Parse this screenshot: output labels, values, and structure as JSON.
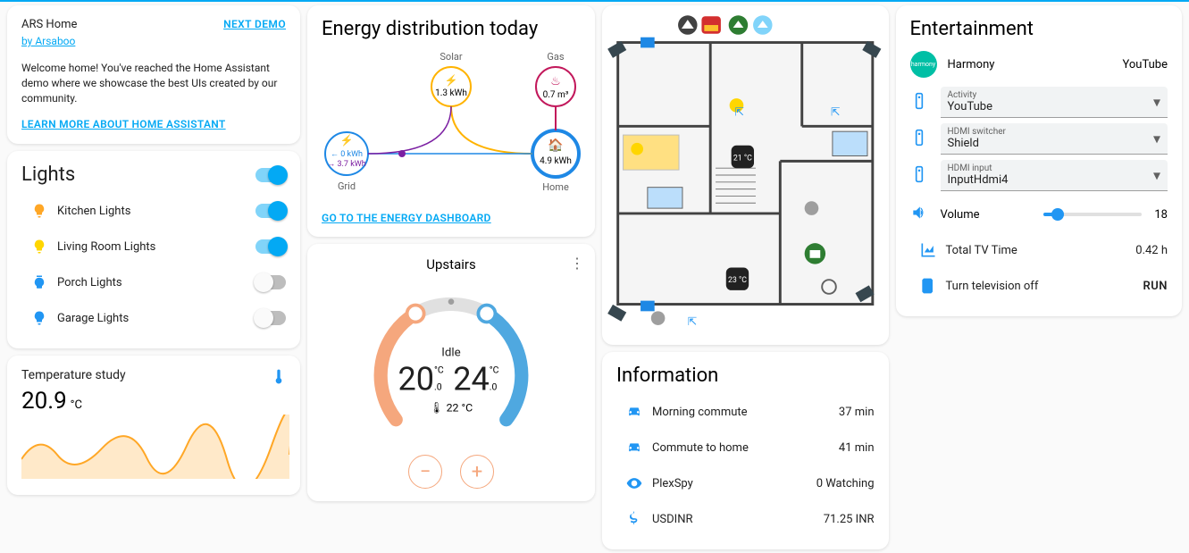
{
  "intro": {
    "title": "ARS Home",
    "author": "by Arsaboo",
    "next": "NEXT DEMO",
    "welcome": "Welcome home! You've reached the Home Assistant demo where we showcase the best UIs created by our community.",
    "learn": "LEARN MORE ABOUT HOME ASSISTANT"
  },
  "lights": {
    "title": "Lights",
    "items": [
      {
        "label": "Kitchen Lights",
        "on": true,
        "color": "#ffa726"
      },
      {
        "label": "Living Room Lights",
        "on": true,
        "color": "#ffd600"
      },
      {
        "label": "Porch Lights",
        "on": false,
        "color": "#2196f3"
      },
      {
        "label": "Garage Lights",
        "on": false,
        "color": "#2196f3"
      }
    ]
  },
  "temperature": {
    "title": "Temperature study",
    "value": "20.9",
    "unit": "°C"
  },
  "energy": {
    "title": "Energy distribution today",
    "solar": {
      "label": "Solar",
      "value": "1.3 kWh"
    },
    "gas": {
      "label": "Gas",
      "value": "0.7 m³"
    },
    "grid": {
      "label": "Grid",
      "in": "← 0 kWh",
      "out": "→ 3.7 kWh"
    },
    "home": {
      "label": "Home",
      "value": "4.9 kWh"
    },
    "link": "GO TO THE ENERGY DASHBOARD"
  },
  "thermostat": {
    "name": "Upstairs",
    "mode": "Idle",
    "low": "20",
    "low_dec": ".0",
    "high": "24",
    "high_dec": ".0",
    "cunit": "°C",
    "current": "22 °C"
  },
  "floorplan": {
    "temp1": "21 °C",
    "temp2": "23 °C"
  },
  "information": {
    "title": "Information",
    "items": [
      {
        "icon": "car",
        "label": "Morning commute",
        "value": "37 min"
      },
      {
        "icon": "car",
        "label": "Commute to home",
        "value": "41 min"
      },
      {
        "icon": "eye",
        "label": "PlexSpy",
        "value": "0 Watching"
      },
      {
        "icon": "dollar",
        "label": "USDINR",
        "value": "71.25 INR"
      }
    ]
  },
  "entertainment": {
    "title": "Entertainment",
    "harmony": {
      "name": "Harmony",
      "state": "YouTube",
      "badge": "harmony"
    },
    "selects": [
      {
        "label": "Activity",
        "value": "YouTube"
      },
      {
        "label": "HDMI switcher",
        "value": "Shield"
      },
      {
        "label": "HDMI input",
        "value": "InputHdmi4"
      }
    ],
    "volume": {
      "label": "Volume",
      "value": "18",
      "pct": 14
    },
    "tvtime": {
      "label": "Total TV Time",
      "value": "0.42 h"
    },
    "tvoff": {
      "label": "Turn television off",
      "action": "RUN"
    }
  }
}
